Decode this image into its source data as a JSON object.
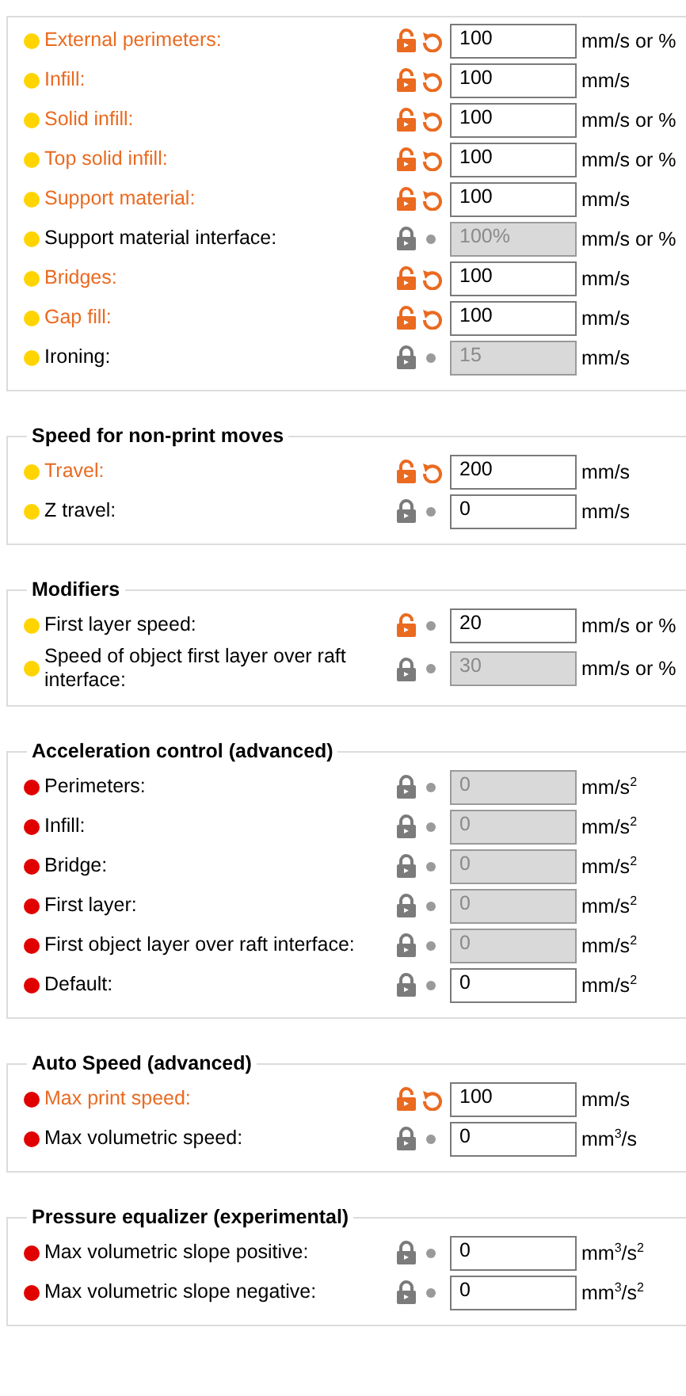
{
  "sections": [
    {
      "rows": [
        {
          "label": "External perimeters:",
          "color": "#ffd400",
          "locked": false,
          "modified": true,
          "value": "100",
          "disabled": false,
          "unit": "mm/s or %"
        },
        {
          "label": "Infill:",
          "color": "#ffd400",
          "locked": false,
          "modified": true,
          "value": "100",
          "disabled": false,
          "unit": "mm/s"
        },
        {
          "label": "Solid infill:",
          "color": "#ffd400",
          "locked": false,
          "modified": true,
          "value": "100",
          "disabled": false,
          "unit": "mm/s or %"
        },
        {
          "label": "Top solid infill:",
          "color": "#ffd400",
          "locked": false,
          "modified": true,
          "value": "100",
          "disabled": false,
          "unit": "mm/s or %"
        },
        {
          "label": "Support material:",
          "color": "#ffd400",
          "locked": false,
          "modified": true,
          "value": "100",
          "disabled": false,
          "unit": "mm/s"
        },
        {
          "label": "Support material interface:",
          "color": "#ffd400",
          "locked": true,
          "modified": false,
          "value": "100%",
          "disabled": true,
          "unit": "mm/s or %"
        },
        {
          "label": "Bridges:",
          "color": "#ffd400",
          "locked": false,
          "modified": true,
          "value": "100",
          "disabled": false,
          "unit": "mm/s"
        },
        {
          "label": "Gap fill:",
          "color": "#ffd400",
          "locked": false,
          "modified": true,
          "value": "100",
          "disabled": false,
          "unit": "mm/s"
        },
        {
          "label": "Ironing:",
          "color": "#ffd400",
          "locked": true,
          "modified": false,
          "value": "15",
          "disabled": true,
          "unit": "mm/s"
        }
      ]
    },
    {
      "title": "Speed for non-print moves",
      "rows": [
        {
          "label": "Travel:",
          "color": "#ffd400",
          "locked": false,
          "modified": true,
          "value": "200",
          "disabled": false,
          "unit": "mm/s"
        },
        {
          "label": "Z travel:",
          "color": "#ffd400",
          "locked": true,
          "modified": false,
          "value": "0",
          "disabled": false,
          "unit": "mm/s"
        }
      ]
    },
    {
      "title": "Modifiers",
      "rows": [
        {
          "label": "First layer speed:",
          "color": "#ffd400",
          "locked": false,
          "modified": false,
          "value": "20",
          "disabled": false,
          "unit": "mm/s or %"
        },
        {
          "label": "Speed of object first layer over raft interface:",
          "color": "#ffd400",
          "locked": true,
          "modified": false,
          "value": "30",
          "disabled": true,
          "unit": "mm/s or %"
        }
      ]
    },
    {
      "title": "Acceleration control (advanced)",
      "rows": [
        {
          "label": "Perimeters:",
          "color": "#e00000",
          "locked": true,
          "modified": false,
          "value": "0",
          "disabled": true,
          "unit": "mm/s$^{2}$"
        },
        {
          "label": "Infill:",
          "color": "#e00000",
          "locked": true,
          "modified": false,
          "value": "0",
          "disabled": true,
          "unit": "mm/s$^{2}$"
        },
        {
          "label": "Bridge:",
          "color": "#e00000",
          "locked": true,
          "modified": false,
          "value": "0",
          "disabled": true,
          "unit": "mm/s$^{2}$"
        },
        {
          "label": "First layer:",
          "color": "#e00000",
          "locked": true,
          "modified": false,
          "value": "0",
          "disabled": true,
          "unit": "mm/s$^{2}$"
        },
        {
          "label": "First object layer over raft interface:",
          "color": "#e00000",
          "locked": true,
          "modified": false,
          "value": "0",
          "disabled": true,
          "unit": "mm/s$^{2}$"
        },
        {
          "label": "Default:",
          "color": "#e00000",
          "locked": true,
          "modified": false,
          "value": "0",
          "disabled": false,
          "unit": "mm/s$^{2}$"
        }
      ]
    },
    {
      "title": "Auto Speed (advanced)",
      "rows": [
        {
          "label": "Max print speed:",
          "color": "#e00000",
          "locked": false,
          "modified": true,
          "value": "100",
          "disabled": false,
          "unit": "mm/s"
        },
        {
          "label": "Max volumetric speed:",
          "color": "#e00000",
          "locked": true,
          "modified": false,
          "value": "0",
          "disabled": false,
          "unit": "mm$^{3}$/s"
        }
      ]
    },
    {
      "title": "Pressure equalizer (experimental)",
      "rows": [
        {
          "label": "Max volumetric slope positive:",
          "color": "#e00000",
          "locked": true,
          "modified": false,
          "value": "0",
          "disabled": false,
          "unit": "mm$^{3}$/s$^{2}$"
        },
        {
          "label": "Max volumetric slope negative:",
          "color": "#e00000",
          "locked": true,
          "modified": false,
          "value": "0",
          "disabled": false,
          "unit": "mm$^{3}$/s$^{2}$"
        }
      ]
    }
  ]
}
